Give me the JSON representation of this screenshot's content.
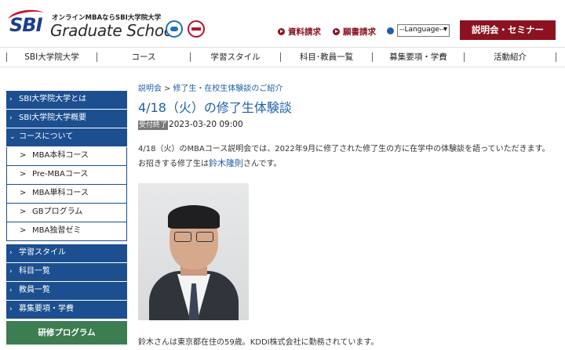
{
  "header": {
    "logo_text": "SBI",
    "tagline": "オンラインMBAならSBI大学院大学",
    "school_name": "Graduate School",
    "links": {
      "shiryo": "資料請求",
      "gansho": "願書請求"
    },
    "language_select": "--Language--",
    "seminar_button": "説明会・セミナー"
  },
  "global_nav": [
    "SBI大学院大学",
    "コース",
    "学習スタイル",
    "科目･教員一覧",
    "募集要項・学費",
    "活動紹介"
  ],
  "sidebar": {
    "items_a": [
      "SBI大学院大学とは",
      "SBI大学院大学概要",
      "コースについて"
    ],
    "sub_items": [
      "MBA本科コース",
      "Pre-MBAコース",
      "MBA単科コース",
      "GBプログラム",
      "MBA独習ゼミ"
    ],
    "items_b": [
      "学習スタイル",
      "科目一覧",
      "教員一覧",
      "募集要項・学費"
    ],
    "training_button": "研修プログラム"
  },
  "main": {
    "breadcrumb": [
      "説明会",
      "修了生・在校生体験談のご紹介"
    ],
    "title": "4/18（火）の修了生体験談",
    "status_badge": "受付終了",
    "datetime": "2023-03-20 09:00",
    "intro_line1": "4/18（火）のMBAコース説明会では、2022年9月に修了された修了生の方に在学中の体験談を語っていただきます。",
    "intro_line2_prefix": "お招きする修了生は",
    "speaker_name": "鈴木隆則",
    "intro_line2_suffix": "さんです。",
    "caption": "鈴木さんは東京都在住の59歳。KDDI株式会社に勤務されています。"
  },
  "colors": {
    "brand_blue": "#1c4f8f",
    "link_blue": "#1f5fa6",
    "accent_red": "#8c1221",
    "training_green": "#3d7d52"
  }
}
